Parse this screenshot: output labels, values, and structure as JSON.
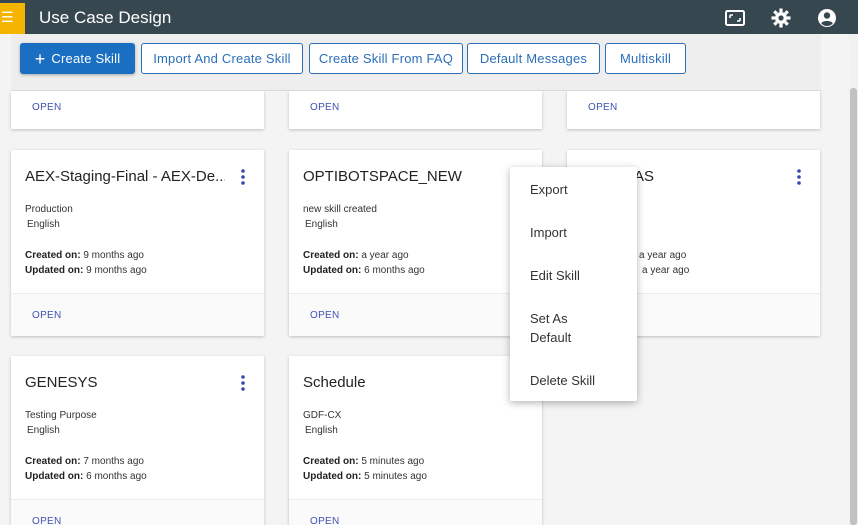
{
  "header": {
    "title": "Use Case Design",
    "icons": [
      "menu-icon",
      "fullscreen-icon",
      "settings-icon",
      "account-icon"
    ],
    "background": "#37474f",
    "menu_accent": "#f5b400"
  },
  "toolbar": {
    "create_skill": "Create Skill",
    "import_and_create": "Import And Create Skill",
    "create_from_faq": "Create Skill From FAQ",
    "default_messages": "Default Messages",
    "multiskill": "Multiskill"
  },
  "top_row": [
    {
      "open": "OPEN"
    },
    {
      "open": "OPEN"
    },
    {
      "open": "OPEN"
    }
  ],
  "cards": [
    {
      "title": "AEX-Staging-Final - AEX-De...",
      "description": "Production",
      "language": "English",
      "created_label": "Created on:",
      "created": "9 months ago",
      "updated_label": "Updated on:",
      "updated": "9 months ago",
      "open": "OPEN"
    },
    {
      "title": "OPTIBOTSPACE_NEW",
      "description": "new skill created",
      "language": "English",
      "created_label": "Created on:",
      "created": "a year ago",
      "updated_label": "Updated on:",
      "updated": "6 months ago",
      "open": "OPEN"
    },
    {
      "title": "AS",
      "description": "",
      "language": "",
      "created_label": "",
      "created": "a year ago",
      "updated_label": "",
      "updated": "a year ago",
      "open": ""
    },
    {
      "title": "GENESYS",
      "description": "Testing Purpose",
      "language": "English",
      "created_label": "Created on:",
      "created": "7 months ago",
      "updated_label": "Updated on:",
      "updated": "6 months ago",
      "open": "OPEN"
    },
    {
      "title": "Schedule",
      "description": "GDF-CX",
      "language": "English",
      "created_label": "Created on:",
      "created": "5 minutes ago",
      "updated_label": "Updated on:",
      "updated": "5 minutes ago",
      "open": "OPEN"
    }
  ],
  "context_menu": {
    "export": "Export",
    "import": "Import",
    "edit_skill": "Edit Skill",
    "set_as_default_line1": "Set As",
    "set_as_default_line2": "Default",
    "delete_skill": "Delete Skill"
  },
  "colors": {
    "primary": "#1a6fc2",
    "link": "#3f51b5"
  }
}
